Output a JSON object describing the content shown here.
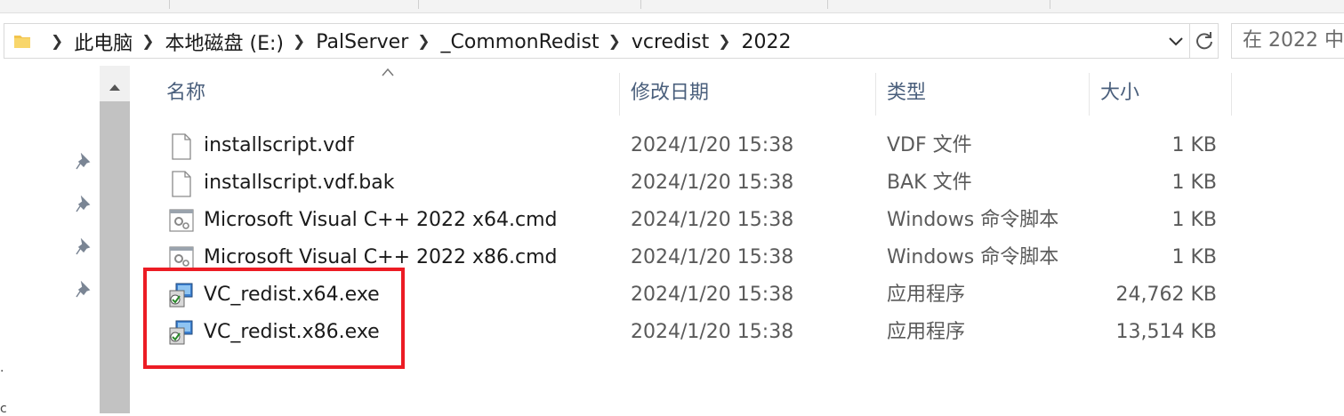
{
  "address_bar": {
    "breadcrumbs": [
      "此电脑",
      "本地磁盘 (E:)",
      "PalServer",
      "_CommonRedist",
      "vcredist",
      "2022"
    ],
    "search_placeholder": "在 2022 中"
  },
  "columns": {
    "name": "名称",
    "modified": "修改日期",
    "type": "类型",
    "size": "大小"
  },
  "files": [
    {
      "name": "installscript.vdf",
      "modified": "2024/1/20 15:38",
      "type": "VDF 文件",
      "size": "1 KB",
      "icon": "document-icon"
    },
    {
      "name": "installscript.vdf.bak",
      "modified": "2024/1/20 15:38",
      "type": "BAK 文件",
      "size": "1 KB",
      "icon": "document-icon"
    },
    {
      "name": "Microsoft Visual C++ 2022 x64.cmd",
      "modified": "2024/1/20 15:38",
      "type": "Windows 命令脚本",
      "size": "1 KB",
      "icon": "cmd-script-icon"
    },
    {
      "name": "Microsoft Visual C++ 2022 x86.cmd",
      "modified": "2024/1/20 15:38",
      "type": "Windows 命令脚本",
      "size": "1 KB",
      "icon": "cmd-script-icon"
    },
    {
      "name": "VC_redist.x64.exe",
      "modified": "2024/1/20 15:38",
      "type": "应用程序",
      "size": "24,762 KB",
      "icon": "installer-icon"
    },
    {
      "name": "VC_redist.x86.exe",
      "modified": "2024/1/20 15:38",
      "type": "应用程序",
      "size": "13,514 KB",
      "icon": "installer-icon"
    }
  ],
  "colors": {
    "highlight": "#ec1c24",
    "header_text": "#4a5f7c",
    "scrollbar_thumb": "#c2c2c2"
  }
}
